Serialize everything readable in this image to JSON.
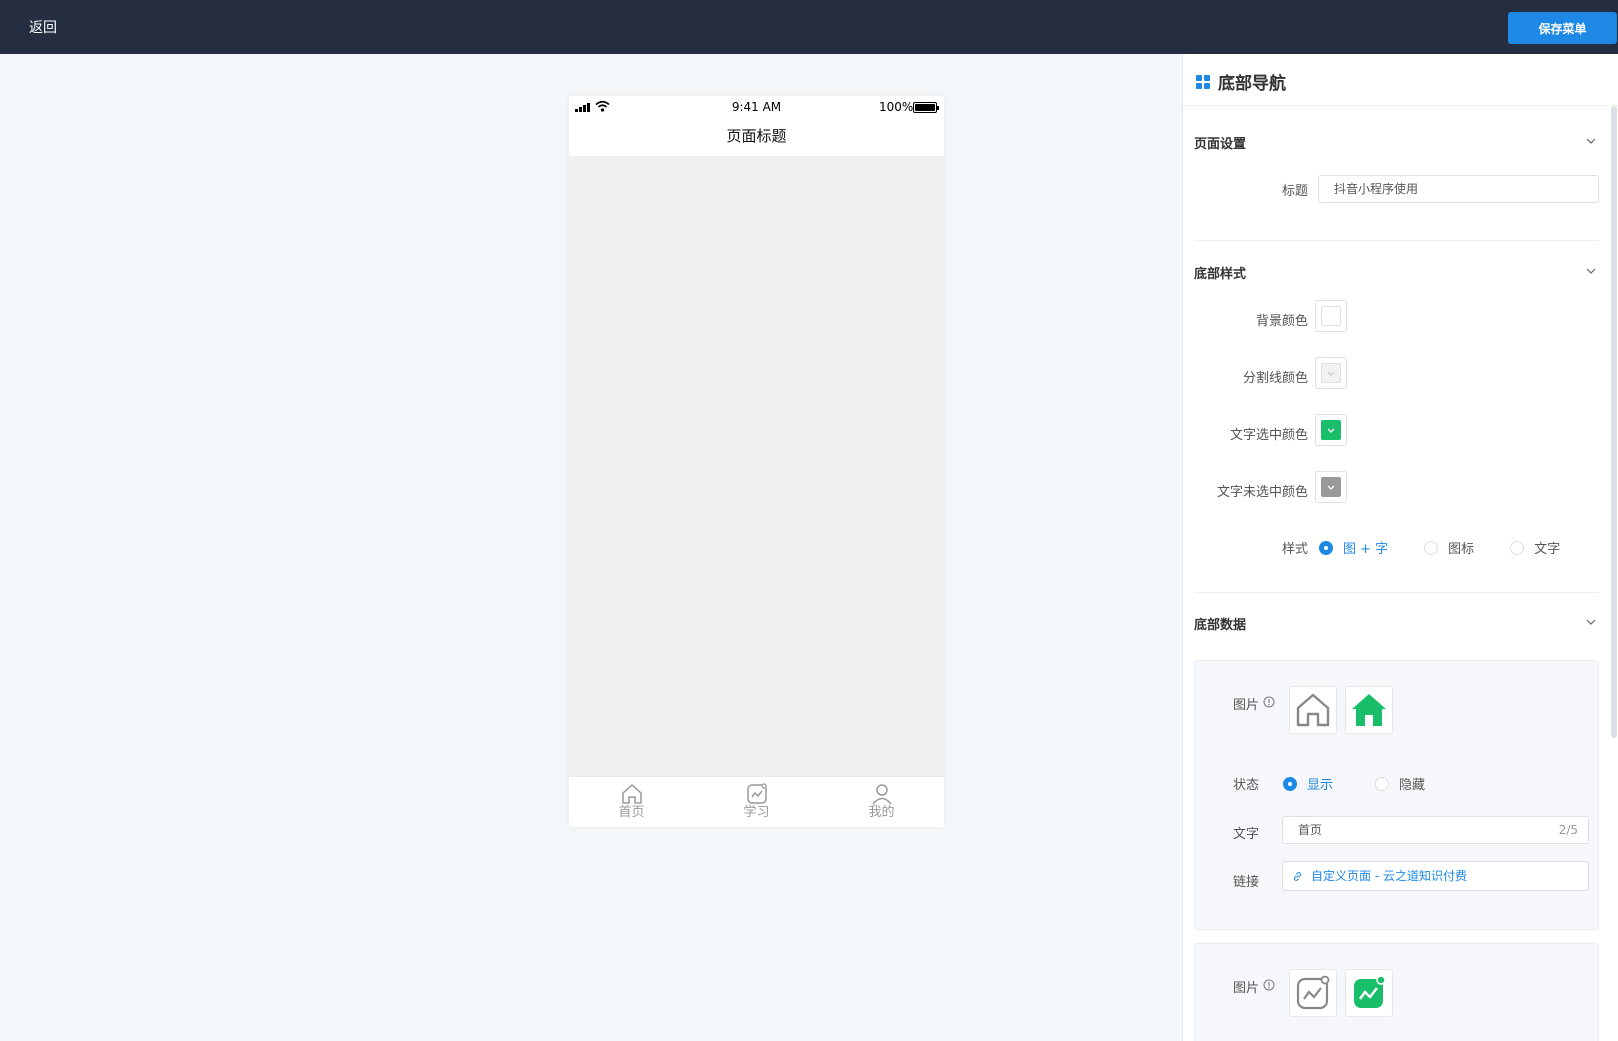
{
  "topbar": {
    "back_label": "返回",
    "save_label": "保存菜单"
  },
  "phone": {
    "status_time": "9:41 AM",
    "battery": "100%",
    "page_title": "页面标题",
    "tabs": [
      {
        "label": "首页",
        "icon": "home-outline-icon"
      },
      {
        "label": "学习",
        "icon": "chart-card-icon"
      },
      {
        "label": "我的",
        "icon": "user-icon"
      }
    ]
  },
  "panel": {
    "title": "底部导航",
    "page_settings": {
      "section_title": "页面设置",
      "title_label": "标题",
      "title_value": "抖音小程序使用"
    },
    "bottom_style": {
      "section_title": "底部样式",
      "bg_color_label": "背景颜色",
      "bg_color": "#ffffff",
      "divider_color_label": "分割线颜色",
      "divider_color": "#f2f2f2",
      "text_selected_label": "文字选中颜色",
      "text_selected_color": "#19be6b",
      "text_unselected_label": "文字未选中颜色",
      "text_unselected_color": "#999999",
      "style_label": "样式",
      "style_options": [
        "图 + 字",
        "图标",
        "文字"
      ],
      "style_selected": "图 + 字"
    },
    "bottom_data": {
      "section_title": "底部数据",
      "items": [
        {
          "image_label": "图片",
          "status_label": "状态",
          "status_options": [
            "显示",
            "隐藏"
          ],
          "status_selected": "显示",
          "text_label": "文字",
          "text_value": "首页",
          "text_counter": "2/5",
          "link_label": "链接",
          "link_value": "自定义页面 - 云之道知识付费"
        },
        {
          "image_label": "图片"
        }
      ]
    }
  },
  "colors": {
    "accent": "#1e88e5",
    "green": "#19be6b",
    "topbar": "#252d41"
  }
}
